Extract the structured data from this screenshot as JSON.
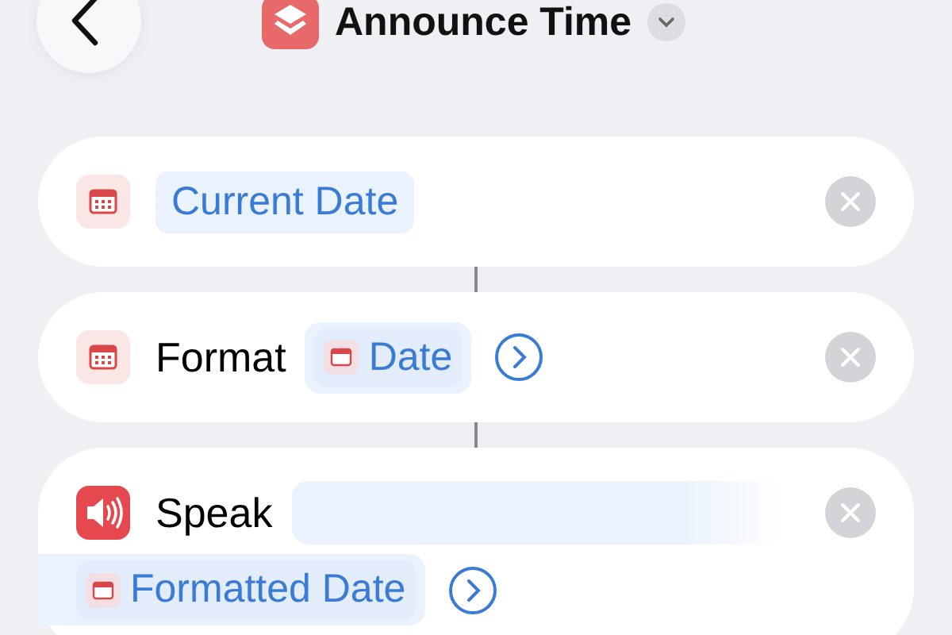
{
  "header": {
    "title": "Announce Time"
  },
  "actions": [
    {
      "kind": "variable",
      "token": "Current Date"
    },
    {
      "kind": "format",
      "label": "Format",
      "token": "Date"
    },
    {
      "kind": "speak",
      "label": "Speak",
      "token": "Formatted Date"
    }
  ]
}
